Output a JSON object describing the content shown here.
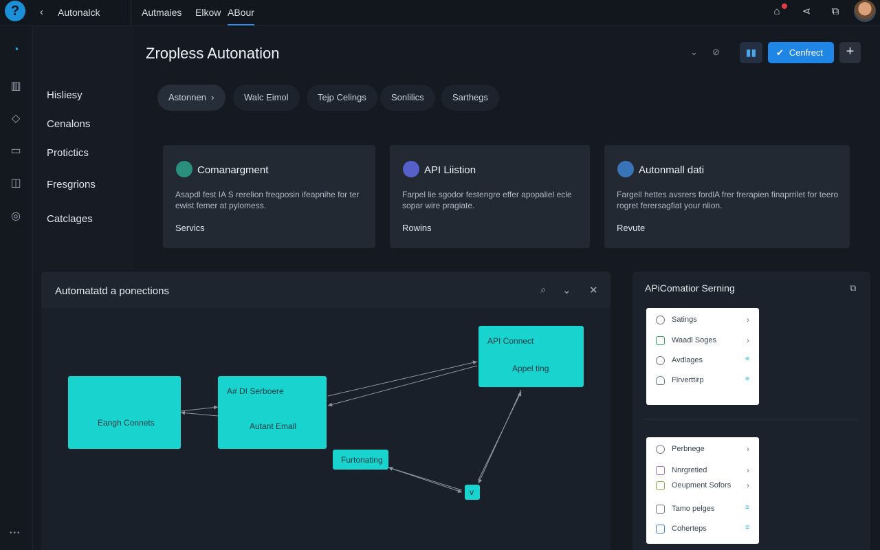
{
  "topbar": {
    "app_name": "Autonalck",
    "tabs": [
      {
        "label": "Autmaies"
      },
      {
        "label": "Elkow"
      },
      {
        "label": "ABour"
      }
    ]
  },
  "left_nav": {
    "items": [
      "Hisliesy",
      "Cenalons",
      "Protictics",
      "Fresgrions",
      "Catclages"
    ]
  },
  "header": {
    "title": "Zropless Autonation",
    "connect_label": "Cenfrect"
  },
  "chips": [
    "Astonnen",
    "Walc Eimol",
    "Tejp Celings",
    "Sonlilics",
    "Sarthegs"
  ],
  "cards": [
    {
      "title": "Comanargment",
      "desc": "Asapdl fest IA S rerelion freqposin ifeapnihe for ter ewist femer at pylomess.",
      "footer": "Servics",
      "avatar_color": "#2b8f7e"
    },
    {
      "title": "API Liistion",
      "desc": "Farpel lie sgodor festengre effer apopaliel ecle sopar wire pragiate.",
      "footer": "Rowins",
      "avatar_color": "#5560c9"
    },
    {
      "title": "Autonmall dati",
      "desc": "Fargell hettes avsrers fordlA frer frerapien finaprrilet for teero rogret ferersagfiat your nlion.",
      "footer": "Revute",
      "avatar_color": "#3a74b8"
    }
  ],
  "flow": {
    "title": "Automatatd a ponections",
    "nodes": [
      {
        "lines": [
          "Eangh Connets"
        ]
      },
      {
        "lines": [
          "A# DI Serboere",
          "Autant Emall"
        ]
      },
      {
        "lines": [
          "API Connect",
          "Appel ting"
        ]
      },
      {
        "lines": [
          "Furtonating"
        ]
      },
      {
        "lines": [
          "v"
        ]
      }
    ]
  },
  "right_panel": {
    "title": "APiComatior Serning",
    "menu1": [
      {
        "label": "Satings",
        "icon": "settings-icon",
        "tail": "›"
      },
      {
        "label": "Waadl Soges",
        "icon": "pages-icon",
        "tail": "›"
      },
      {
        "label": "Avdlages",
        "icon": "gear-icon",
        "tail": "≡"
      },
      {
        "label": "Flrverttirp",
        "icon": "user-icon",
        "tail": "≡"
      }
    ],
    "menu2": [
      {
        "label": "Perbnege",
        "icon": "settings-icon",
        "tail": "›"
      },
      {
        "label": "Nnrgretied",
        "icon": "tag-icon",
        "tail": "›"
      },
      {
        "label": "Oeupment Sofors",
        "icon": "doc-icon",
        "tail": "›"
      },
      {
        "label": "Tamo pelges",
        "icon": "table-icon",
        "tail": "≡"
      },
      {
        "label": "Coherteps",
        "icon": "grid-icon",
        "tail": "≡"
      }
    ]
  }
}
